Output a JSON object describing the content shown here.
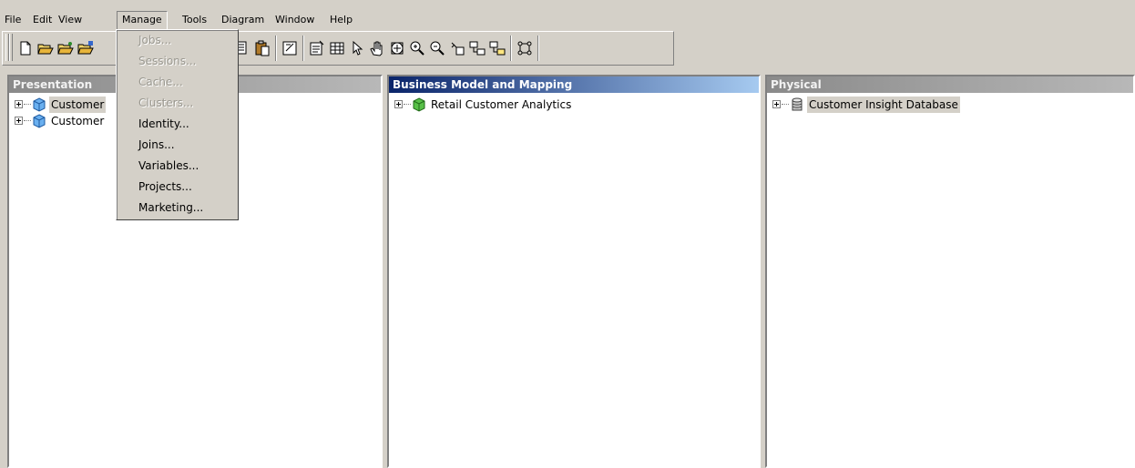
{
  "menubar": {
    "items": [
      "File",
      "Edit",
      "View",
      "Manage",
      "Tools",
      "Diagram",
      "Window",
      "Help"
    ],
    "active": "Manage"
  },
  "toolbar": {
    "buttons": [
      "new-icon",
      "open-icon",
      "open-offline-icon",
      "open-online-icon",
      "copy-icon",
      "paste-icon",
      "check-in-icon",
      "properties-icon",
      "table-icon",
      "select-arrow-icon",
      "pan-hand-icon",
      "zoom-fit-icon",
      "zoom-in-icon",
      "zoom-out-icon",
      "add-join-icon",
      "join-icon",
      "complex-join-icon",
      "hierarchy-icon"
    ]
  },
  "manage_menu": {
    "items": [
      {
        "label": "Jobs...",
        "enabled": false
      },
      {
        "label": "Sessions...",
        "enabled": false
      },
      {
        "label": "Cache...",
        "enabled": false
      },
      {
        "label": "Clusters...",
        "enabled": false
      },
      {
        "label": "Identity...",
        "enabled": true
      },
      {
        "label": "Joins...",
        "enabled": true
      },
      {
        "label": "Variables...",
        "enabled": true
      },
      {
        "label": "Projects...",
        "enabled": true
      },
      {
        "label": "Marketing...",
        "enabled": true
      }
    ]
  },
  "panes": {
    "presentation": {
      "title": "Presentation",
      "nodes": [
        {
          "label": "Customer",
          "icon": "presentation-catalog-icon",
          "selected": true
        },
        {
          "label": "Customer",
          "icon": "presentation-catalog-icon",
          "selected": false
        }
      ]
    },
    "business": {
      "title": "Business Model and Mapping",
      "nodes": [
        {
          "label": "Retail Customer Analytics",
          "icon": "business-model-icon",
          "selected": false
        }
      ]
    },
    "physical": {
      "title": "Physical",
      "nodes": [
        {
          "label": "Customer Insight Database",
          "icon": "database-icon",
          "selected": true
        }
      ]
    }
  },
  "colors": {
    "chrome": "#d4d0c8",
    "active_header": "#0a246a",
    "inactive_header": "#8a8a8a"
  }
}
